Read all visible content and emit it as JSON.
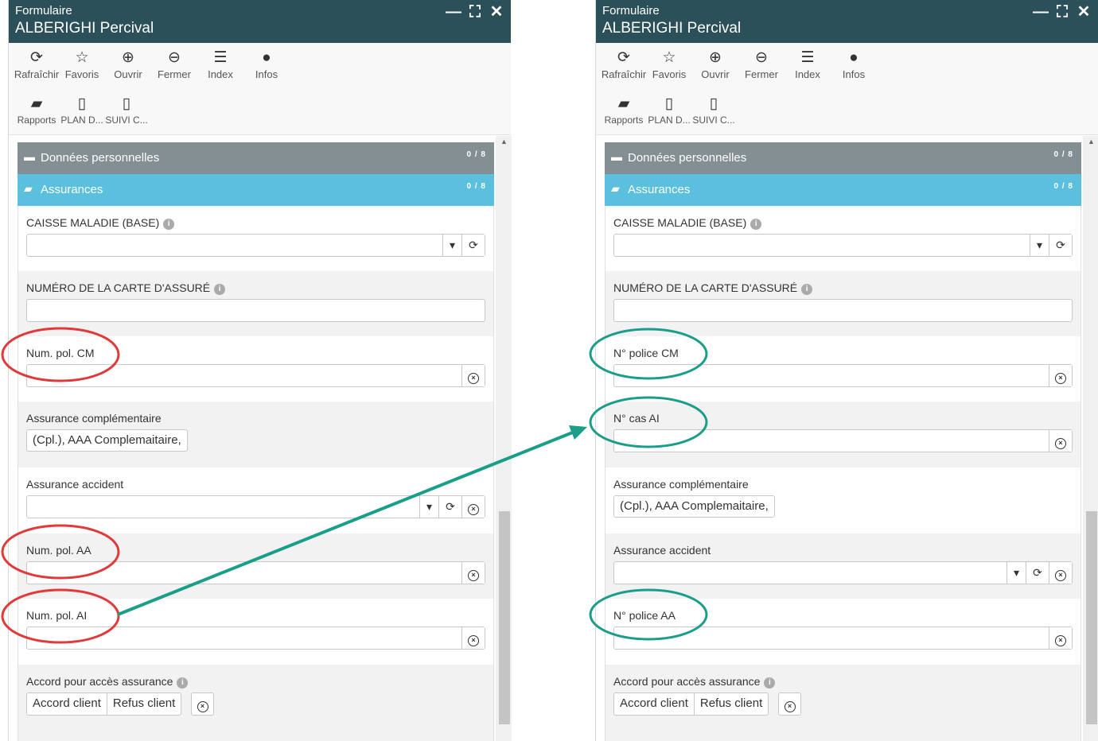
{
  "window": {
    "subtitle": "Formulaire",
    "title": "ALBERIGHI Percival",
    "controls": {
      "minimize": "—",
      "maximize": "⛶",
      "close": "✕"
    }
  },
  "toolbar": {
    "refresh": "Rafraîchir",
    "favorites": "Favoris",
    "open": "Ouvrir",
    "close": "Fermer",
    "index": "Index",
    "infos": "Infos",
    "rapports": "Rapports",
    "plan": "PLAN D...",
    "suivi": "SUIVI C..."
  },
  "panels": {
    "personal": {
      "label": "Données personnelles",
      "count": "0 / 8"
    },
    "insurance": {
      "label": "Assurances",
      "count": "0 / 8"
    }
  },
  "fields": {
    "caisse": "CAISSE MALADIE (BASE)",
    "carte": "NUMÉRO DE LA CARTE D'ASSURÉ",
    "complementaire": "Assurance complémentaire",
    "complementaire_value": "(Cpl.), AAA Complemaitaire,",
    "accident": "Assurance accident",
    "accord": "Accord pour accès assurance",
    "accord_client": "Accord client",
    "refus_client": "Refus client"
  },
  "left_labels": {
    "cm": "Num. pol. CM",
    "aa": "Num. pol. AA",
    "ai": "Num. pol. AI"
  },
  "right_labels": {
    "cm": "N° police CM",
    "ai": "N° cas AI",
    "aa": "N° police AA"
  },
  "colors": {
    "titlebar": "#2b5059",
    "panel_personal": "#838f93",
    "panel_insurance": "#5bc0de",
    "old_highlight": "#e03a3a",
    "new_highlight": "#1a9e8a"
  }
}
